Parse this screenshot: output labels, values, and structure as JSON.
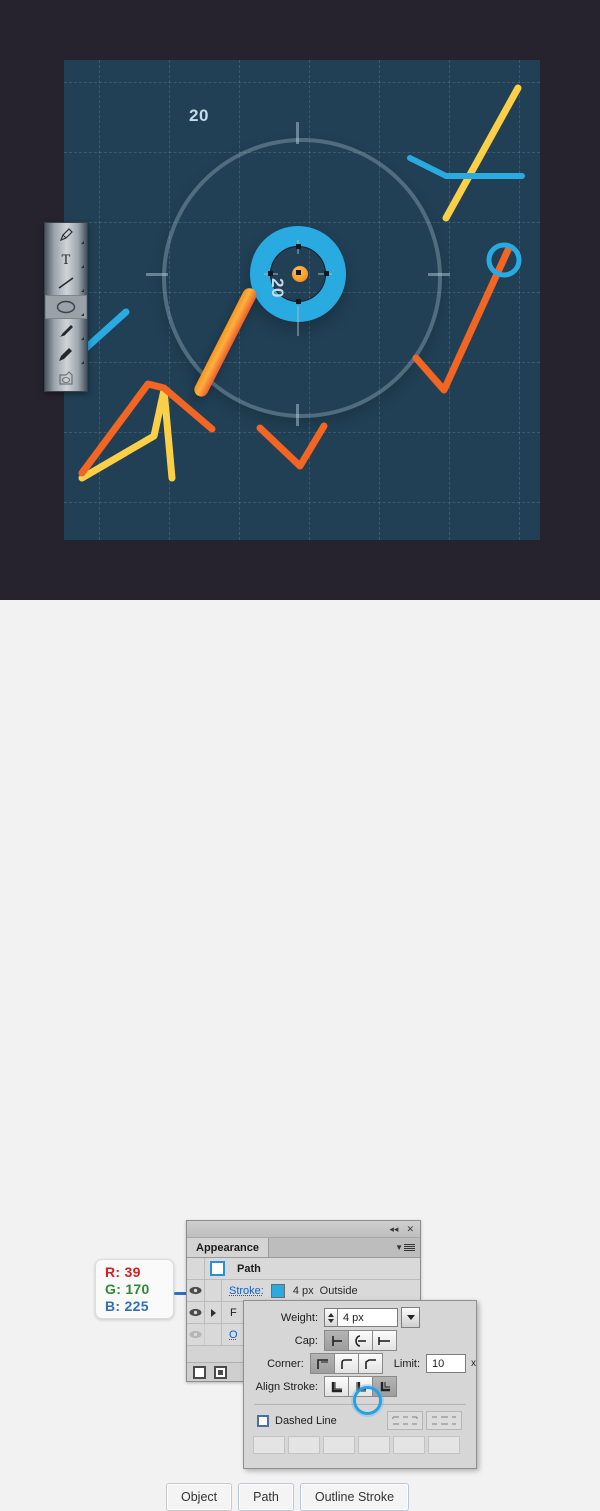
{
  "artwork": {
    "gauge_value_top": "20",
    "gauge_value_right": "20",
    "colors": {
      "canvas_background": "#214055",
      "stage_background": "#26232f",
      "accent_cyan": "#29abe2",
      "needle_orange": "#f7941e",
      "needle_red": "#f15a29",
      "label_text": "#c5dcea"
    }
  },
  "toolbar": {
    "tools": [
      {
        "name": "pen-tool",
        "label": "Pen Tool",
        "selected": false
      },
      {
        "name": "type-tool",
        "label": "Type Tool",
        "selected": false
      },
      {
        "name": "line-segment-tool",
        "label": "Line Segment Tool",
        "selected": false
      },
      {
        "name": "ellipse-tool",
        "label": "Ellipse Tool",
        "selected": true
      },
      {
        "name": "paintbrush-tool",
        "label": "Paintbrush Tool",
        "selected": false
      },
      {
        "name": "pencil-tool",
        "label": "Pencil Tool",
        "selected": false
      },
      {
        "name": "blob-brush-tool",
        "label": "Blob Brush Tool",
        "selected": false
      }
    ]
  },
  "appearance_panel": {
    "tab_label": "Appearance",
    "collapse_icon": "◂◂",
    "close_icon": "✕",
    "rows": {
      "path_label": "Path",
      "stroke_label": "Stroke:",
      "stroke_weight": "4 px",
      "stroke_align": "Outside",
      "fill_label": "F",
      "opacity_label": "O"
    }
  },
  "stroke_panel": {
    "weight_label": "Weight:",
    "weight_value": "4 px",
    "cap_label": "Cap:",
    "corner_label": "Corner:",
    "limit_label": "Limit:",
    "limit_value": "10",
    "limit_unit": "x",
    "align_stroke_label": "Align Stroke:",
    "dashed_line_label": "Dashed Line",
    "cap_options": [
      "butt-cap",
      "round-cap",
      "projecting-cap"
    ],
    "cap_selected_index": 0,
    "corner_options": [
      "miter-join",
      "round-join",
      "bevel-join"
    ],
    "corner_selected_index": 0,
    "align_options": [
      "align-center",
      "align-inside",
      "align-outside"
    ],
    "align_selected_index": 2
  },
  "color_callout": {
    "r_label": "R: 39",
    "g_label": "G: 170",
    "b_label": "B: 225",
    "hex": "#27AAE1"
  },
  "bottom_buttons": {
    "object": "Object",
    "path": "Path",
    "outline_stroke": "Outline Stroke"
  }
}
